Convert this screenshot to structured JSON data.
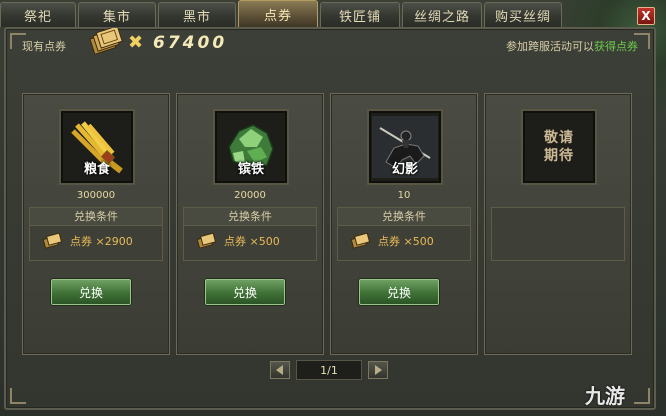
{
  "tabs": [
    "祭祀",
    "集市",
    "黑市",
    "点券",
    "铁匠铺",
    "丝绸之路",
    "购买丝绸"
  ],
  "active_tab": "点券",
  "close_label": "X",
  "header": {
    "coupon_label": "现有点券",
    "times_sign": "✖",
    "amount": "67400",
    "event_text": "参加跨服活动可以",
    "event_link": "获得点券"
  },
  "cards": [
    {
      "name": "粮食",
      "qty": "300000",
      "cond_title": "兑换条件",
      "cost": "点券 ×2900",
      "button": "兑换",
      "icon": "grain-icon"
    },
    {
      "name": "镔铁",
      "qty": "20000",
      "cond_title": "兑换条件",
      "cost": "点券 ×500",
      "button": "兑换",
      "icon": "iron-ore-icon"
    },
    {
      "name": "幻影",
      "qty": "10",
      "cond_title": "兑换条件",
      "cost": "点券 ×500",
      "button": "兑换",
      "icon": "phantom-rider-icon"
    }
  ],
  "placeholder": {
    "line1": "敬请",
    "line2": "期待"
  },
  "pager": {
    "text": "1/1"
  },
  "watermark": "九游",
  "colors": {
    "accent_green": "#6ec94a",
    "cost_gold": "#e9b957",
    "active_tab": "#8a7b55"
  }
}
